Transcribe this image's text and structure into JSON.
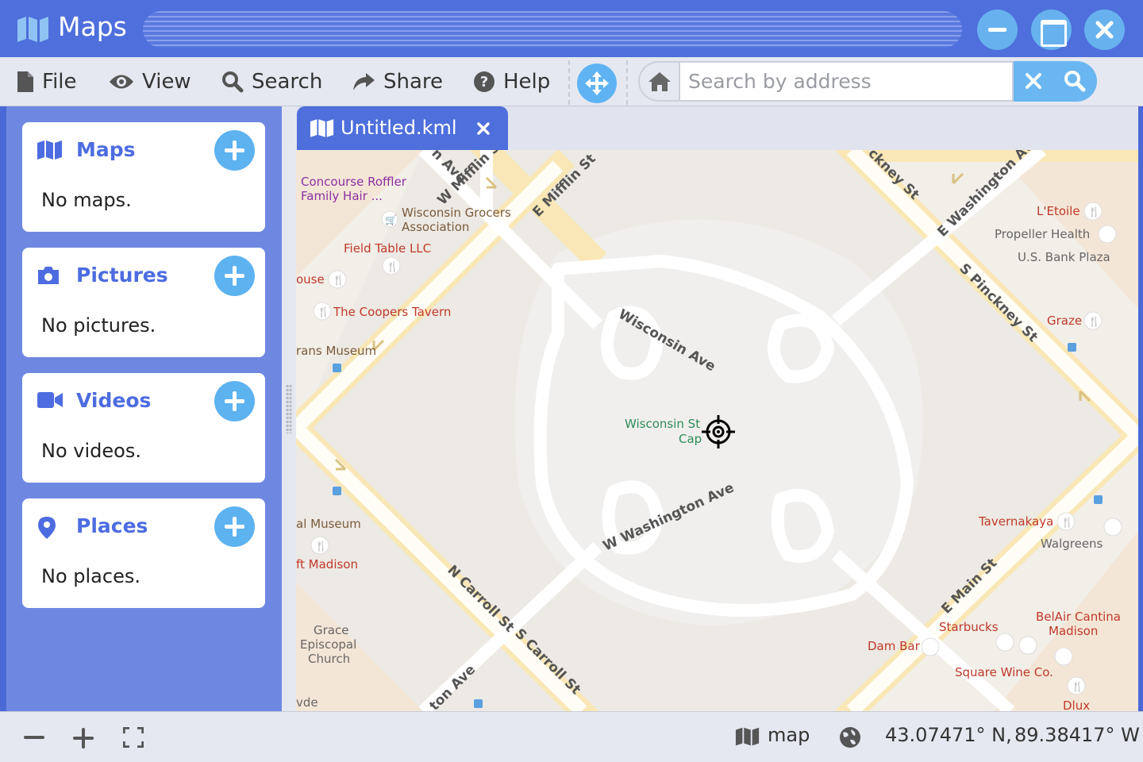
{
  "window": {
    "title": "Maps"
  },
  "menu": {
    "file": "File",
    "view": "View",
    "search": "Search",
    "share": "Share",
    "help": "Help"
  },
  "search": {
    "placeholder": "Search by address",
    "value": ""
  },
  "sidebar": {
    "panels": [
      {
        "title": "Maps",
        "empty": "No maps.",
        "icon": "map-icon"
      },
      {
        "title": "Pictures",
        "empty": "No pictures.",
        "icon": "camera-icon"
      },
      {
        "title": "Videos",
        "empty": "No videos.",
        "icon": "video-icon"
      },
      {
        "title": "Places",
        "empty": "No places.",
        "icon": "pin-icon"
      }
    ]
  },
  "tabs": [
    {
      "label": "Untitled.kml",
      "active": true
    }
  ],
  "map": {
    "streets": [
      "W Mifflin St",
      "E Mifflin St",
      "E Washington Av",
      "S Pinckney St",
      "E Main St",
      "N Carroll St",
      "S Carroll St",
      "Wisconsin Ave",
      "W Washington Ave",
      "ckney St",
      "n Ave",
      "ton Ave"
    ],
    "places": [
      "Concourse Roffler Family Hair ...",
      "Wisconsin Grocers Association",
      "Field Table LLC",
      "ouse",
      "The Coopers Tavern",
      "rans Museum",
      "al Museum",
      "ft Madison",
      "Grace Episcopal Church",
      "vde",
      "L'Etoile",
      "Propeller Health",
      "U.S. Bank Plaza",
      "Graze",
      "Tavernakaya",
      "Walgreens",
      "BelAir Cantina Madison",
      "Starbucks",
      "Dam Bar",
      "Square Wine Co.",
      "Dlux",
      "Wisconsin St",
      "Cap"
    ]
  },
  "status": {
    "mode_label": "map",
    "latitude": "43.07471° N,",
    "longitude": "89.38417° W"
  },
  "colors": {
    "accent": "#4e6fdc",
    "button": "#5db2f0",
    "sidebar": "#6e88e2"
  }
}
